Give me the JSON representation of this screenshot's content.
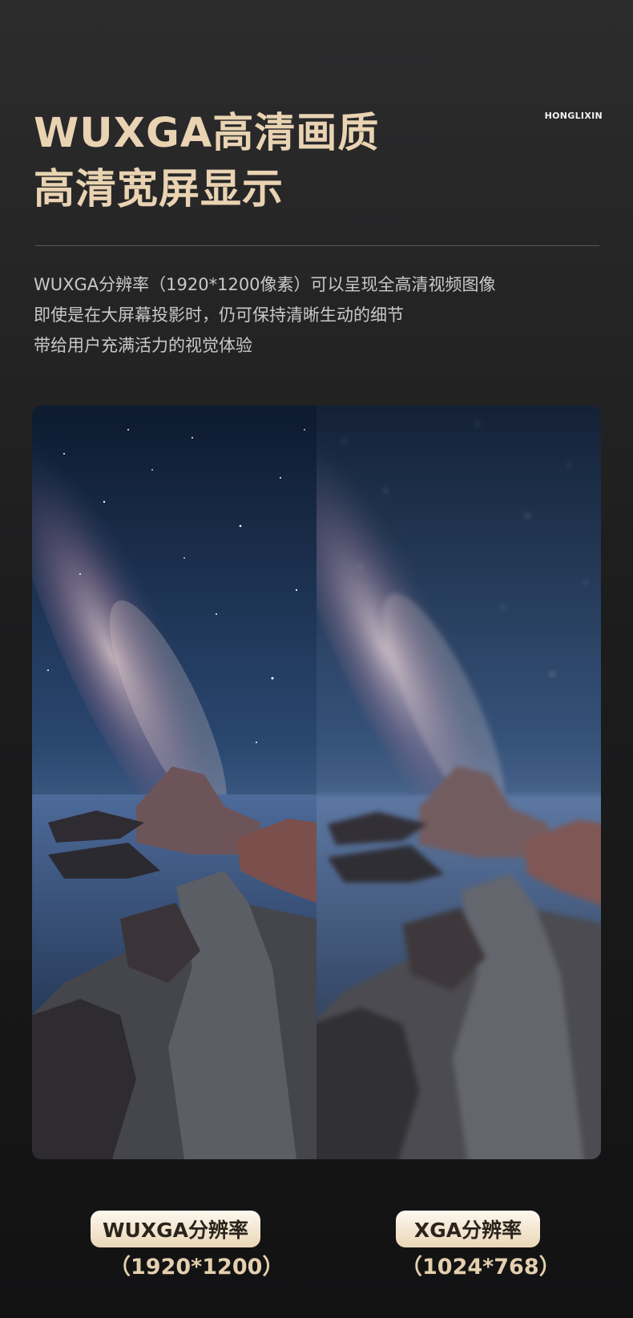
{
  "header": {
    "title_line1": "WUXGA高清画质",
    "title_line2": "高清宽屏显示",
    "brand": "HONGLIXIN"
  },
  "description": {
    "line1": "WUXGA分辨率（1920*1200像素）可以呈现全高清视频图像",
    "line2": "即使是在大屏幕投影时，仍可保持清晰生动的细节",
    "line3": "带给用户充满活力的视觉体验"
  },
  "comparison": {
    "left": {
      "label": "WUXGA分辨率",
      "resolution": "（1920*1200）"
    },
    "right": {
      "label": "XGA分辨率",
      "resolution": "（1024*768）"
    }
  },
  "colors": {
    "title": "#e9d3b2",
    "pill": "#f3e6cf",
    "background": "#1d1d1e"
  }
}
